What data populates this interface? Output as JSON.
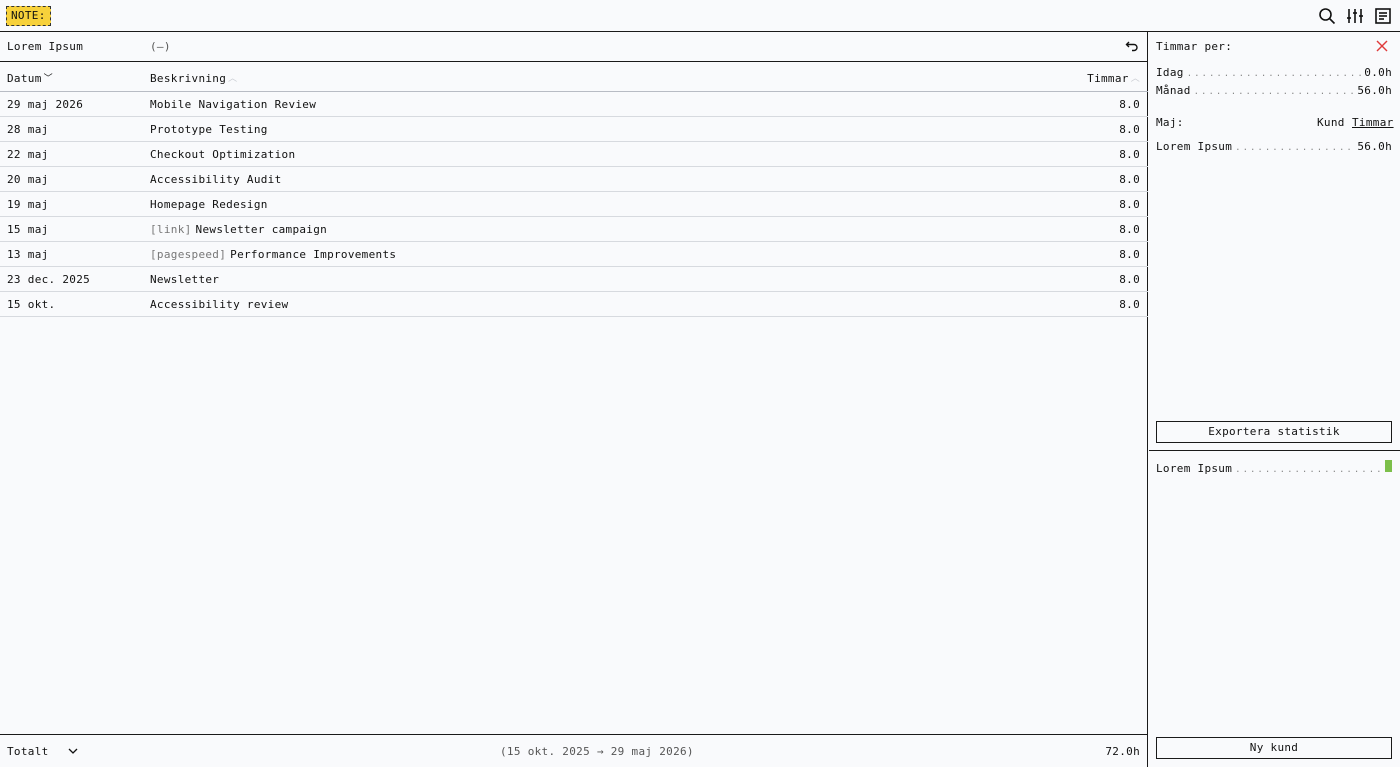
{
  "app": {
    "logo": "NOTE:"
  },
  "toolbar": {
    "icons": [
      "search-icon",
      "sliders-icon",
      "notes-icon"
    ]
  },
  "client_bar": {
    "name": "Lorem Ipsum",
    "extra": "(—)",
    "undo_icon": "undo-icon"
  },
  "table": {
    "headers": {
      "date": "Datum",
      "description": "Beskrivning",
      "hours": "Timmar"
    },
    "rows": [
      {
        "date": "29 maj 2026",
        "tag": "",
        "description": "Mobile Navigation Review",
        "hours": "8.0"
      },
      {
        "date": "28 maj",
        "tag": "",
        "description": "Prototype Testing",
        "hours": "8.0"
      },
      {
        "date": "22 maj",
        "tag": "",
        "description": "Checkout Optimization",
        "hours": "8.0"
      },
      {
        "date": "20 maj",
        "tag": "",
        "description": "Accessibility Audit",
        "hours": "8.0"
      },
      {
        "date": "19 maj",
        "tag": "",
        "description": "Homepage Redesign",
        "hours": "8.0"
      },
      {
        "date": "15 maj",
        "tag": "[link]",
        "description": "Newsletter campaign",
        "hours": "8.0"
      },
      {
        "date": "13 maj",
        "tag": "[pagespeed]",
        "description": "Performance Improvements",
        "hours": "8.0"
      },
      {
        "date": "23 dec. 2025",
        "tag": "",
        "description": "Newsletter",
        "hours": "8.0"
      },
      {
        "date": "15 okt.",
        "tag": "",
        "description": "Accessibility review",
        "hours": "8.0"
      }
    ]
  },
  "footer": {
    "label": "Totalt",
    "range": "(15 okt. 2025 → 29 maj 2026)",
    "total": "72.0h"
  },
  "sidebar": {
    "title": "Timmar per:",
    "today_label": "Idag",
    "today_value": "0.0h",
    "month_label": "Månad",
    "month_value": "56.0h",
    "period_label": "Maj:",
    "sort_client": "Kund",
    "sort_hours": "Timmar",
    "client_name": "Lorem Ipsum",
    "client_value": "56.0h",
    "export_button": "Exportera statistik",
    "bar_client": "Lorem Ipsum",
    "new_client_button": "Ny kund",
    "accent_color": "#7cbf4a",
    "close_color": "#e03a3a"
  }
}
